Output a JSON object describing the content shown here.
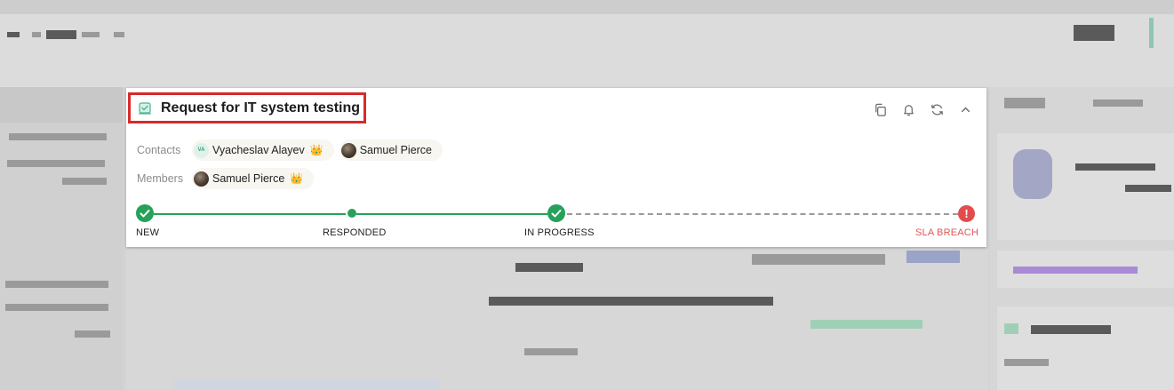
{
  "ticket": {
    "title": "Request for IT system testing",
    "actions": [
      {
        "name": "copy-icon"
      },
      {
        "name": "bell-icon"
      },
      {
        "name": "refresh-icon"
      },
      {
        "name": "chevron-up-icon"
      }
    ]
  },
  "contacts": {
    "label": "Contacts",
    "people": [
      {
        "name": "Vyacheslav Alayev",
        "initials": "VA",
        "owner": true
      },
      {
        "name": "Samuel Pierce",
        "initials": "",
        "owner": false
      }
    ]
  },
  "members": {
    "label": "Members",
    "people": [
      {
        "name": "Samuel Pierce",
        "initials": "",
        "owner": true
      }
    ]
  },
  "progress": {
    "stages": [
      {
        "label": "NEW",
        "status": "done"
      },
      {
        "label": "RESPONDED",
        "status": "reached"
      },
      {
        "label": "IN PROGRESS",
        "status": "done"
      },
      {
        "label": "SLA BREACH",
        "status": "alert"
      }
    ]
  },
  "colors": {
    "accent_green": "#27a15a",
    "alert_red": "#e24c4c",
    "highlight_border": "#d72a2a"
  },
  "icons": {
    "crown": "👑",
    "alert": "!"
  }
}
